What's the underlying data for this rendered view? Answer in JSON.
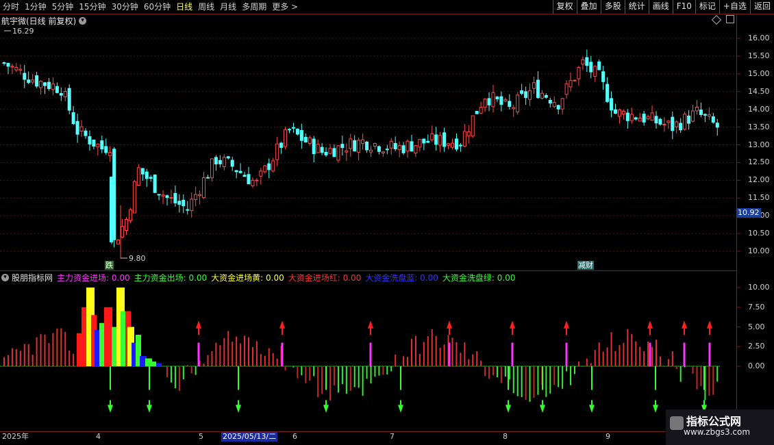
{
  "toolbar": {
    "periods": [
      "分时",
      "1分钟",
      "5分钟",
      "15分钟",
      "30分钟",
      "60分钟",
      "日线",
      "周线",
      "月线",
      "多周期",
      "更多 >"
    ],
    "active_period": "日线",
    "tools": [
      "复权",
      "叠加",
      "多股",
      "统计",
      "画线",
      "F10",
      "标记",
      "+自选",
      "返回"
    ]
  },
  "chart_header": {
    "title": "航宇微(日线 前复权)",
    "circle_icon": "chevron-down-icon"
  },
  "price_axis": {
    "ticks": [
      "16.00",
      "15.50",
      "15.00",
      "14.50",
      "14.00",
      "13.50",
      "13.00",
      "12.50",
      "12.00",
      "11.50",
      "11.00",
      "10.50",
      "10.00"
    ],
    "current_price": "10.92"
  },
  "extremes": {
    "high": "16.29",
    "low": "9.80"
  },
  "signals": {
    "left": "跌",
    "right": "减财"
  },
  "indicator": {
    "name": "股朋指标网",
    "items": [
      {
        "label": "主力资金进场: 0.00",
        "color": "#ff33ff"
      },
      {
        "label": "主力资金出场: 0.00",
        "color": "#33ff33"
      },
      {
        "label": "大资金进场黄: 0.00",
        "color": "#ffff33"
      },
      {
        "label": "大资金进场红: 0.00",
        "color": "#ff3333"
      },
      {
        "label": "大资金洗盘蓝: 0.00",
        "color": "#3333ff"
      },
      {
        "label": "大资金洗盘绿: 0.00",
        "color": "#33ff33"
      }
    ],
    "axis_ticks": [
      "10.00",
      "7.50",
      "5.00",
      "2.50",
      "0.00"
    ]
  },
  "dates": {
    "labels": [
      "2025年",
      "4",
      "5",
      "2025/05/13/二",
      "6",
      "7",
      "8",
      "9"
    ]
  },
  "watermark": {
    "title": "指标公式网",
    "url": "www.zbgs3.com"
  }
}
